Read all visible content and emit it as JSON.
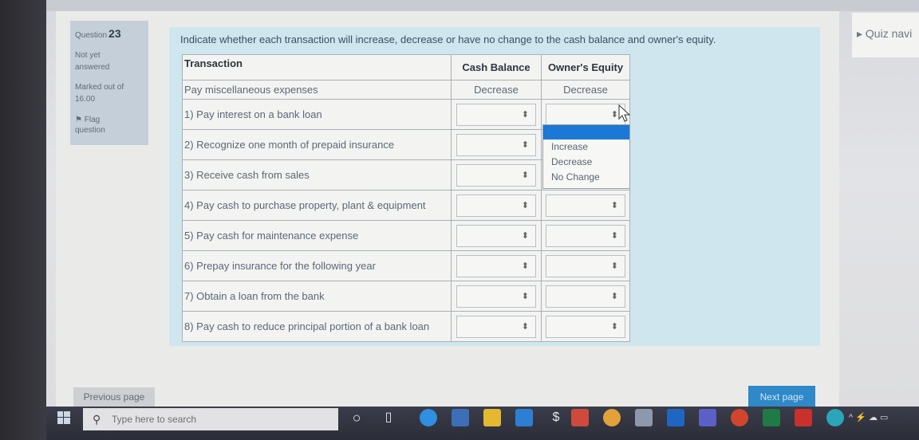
{
  "question": {
    "label": "Question",
    "number": "23",
    "state_line1": "Not yet",
    "state_line2": "answered",
    "marked_line1": "Marked out of",
    "marked_line2": "16.00",
    "flag_line1": "Flag",
    "flag_line2": "question"
  },
  "prompt": "Indicate whether each transaction will increase, decrease or have no change to the cash balance and owner's equity.",
  "table": {
    "headers": [
      "Transaction",
      "Cash Balance",
      "Owner's Equity"
    ],
    "example": [
      "Pay miscellaneous expenses",
      "Decrease",
      "Decrease"
    ],
    "rows": [
      "1) Pay interest on a bank loan",
      "2) Recognize one month of prepaid insurance",
      "3) Receive cash from sales",
      "4) Pay cash to purchase property, plant & equipment",
      "5) Pay cash for maintenance expense",
      "6) Prepay insurance for the following year",
      "7) Obtain a loan from the bank",
      "8) Pay cash to reduce principal portion of a bank loan"
    ]
  },
  "dropdown": {
    "options": [
      "Increase",
      "Decrease",
      "No Change"
    ]
  },
  "quiz_nav": "Quiz navi",
  "previous_page": "Previous page",
  "next_page": "Next page",
  "taskbar": {
    "search_placeholder": "Type here to search"
  },
  "colors": {
    "question_bg": "#cfe6ee",
    "info_box": "#c5cfd9",
    "highlight": "#1b78d6",
    "next_button": "#2f88c8"
  }
}
